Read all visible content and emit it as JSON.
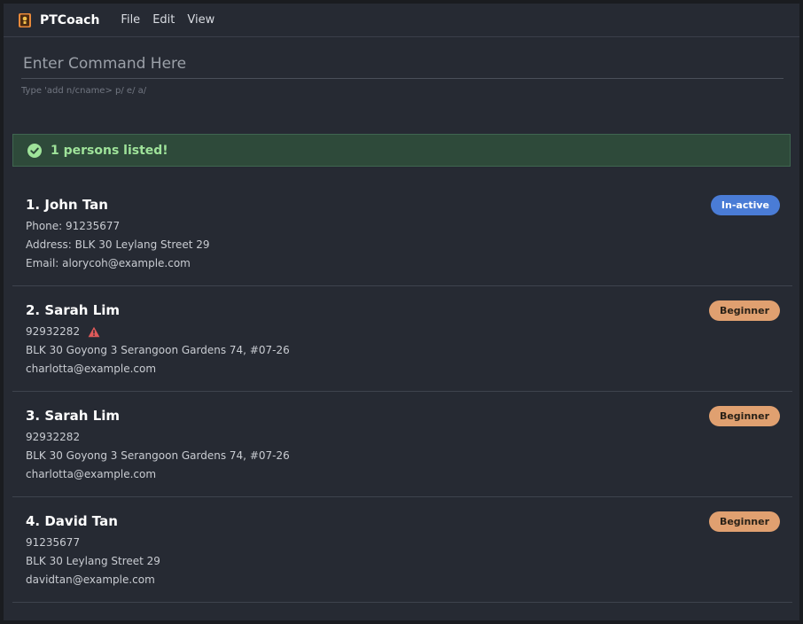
{
  "app": {
    "title": "PTCoach",
    "icon": "book-icon"
  },
  "menu": {
    "items": [
      "File",
      "Edit",
      "View"
    ]
  },
  "command": {
    "placeholder": "Enter Command Here",
    "value": "",
    "hint": "Type 'add n/cname> p/ e/ a/"
  },
  "result": {
    "text": "1 persons listed!",
    "icon": "check-circle-icon",
    "color": "#9fe39a"
  },
  "persons": [
    {
      "name": "1. John Tan",
      "phone": "Phone: 91235677",
      "address": "Address: BLK 30 Leylang Street 29",
      "email": "Email: alorycoh@example.com",
      "badge": "In-active",
      "badge_type": "inactive",
      "warning": false
    },
    {
      "name": "2. Sarah Lim",
      "phone": "92932282",
      "address": "BLK 30 Goyong 3 Serangoon Gardens 74, #07-26",
      "email": "charlotta@example.com",
      "badge": "Beginner",
      "badge_type": "beginner",
      "warning": true
    },
    {
      "name": "3. Sarah Lim",
      "phone": "92932282",
      "address": "BLK 30 Goyong 3 Serangoon Gardens 74, #07-26",
      "email": "charlotta@example.com",
      "badge": "Beginner",
      "badge_type": "beginner",
      "warning": false
    },
    {
      "name": "4. David Tan",
      "phone": "91235677",
      "address": "BLK 30 Leylang Street 29",
      "email": "davidtan@example.com",
      "badge": "Beginner",
      "badge_type": "beginner",
      "warning": false
    }
  ],
  "colors": {
    "inactive_badge": "#4a7cd6",
    "beginner_badge": "#e0a070",
    "warning_icon": "#e05a5a"
  }
}
